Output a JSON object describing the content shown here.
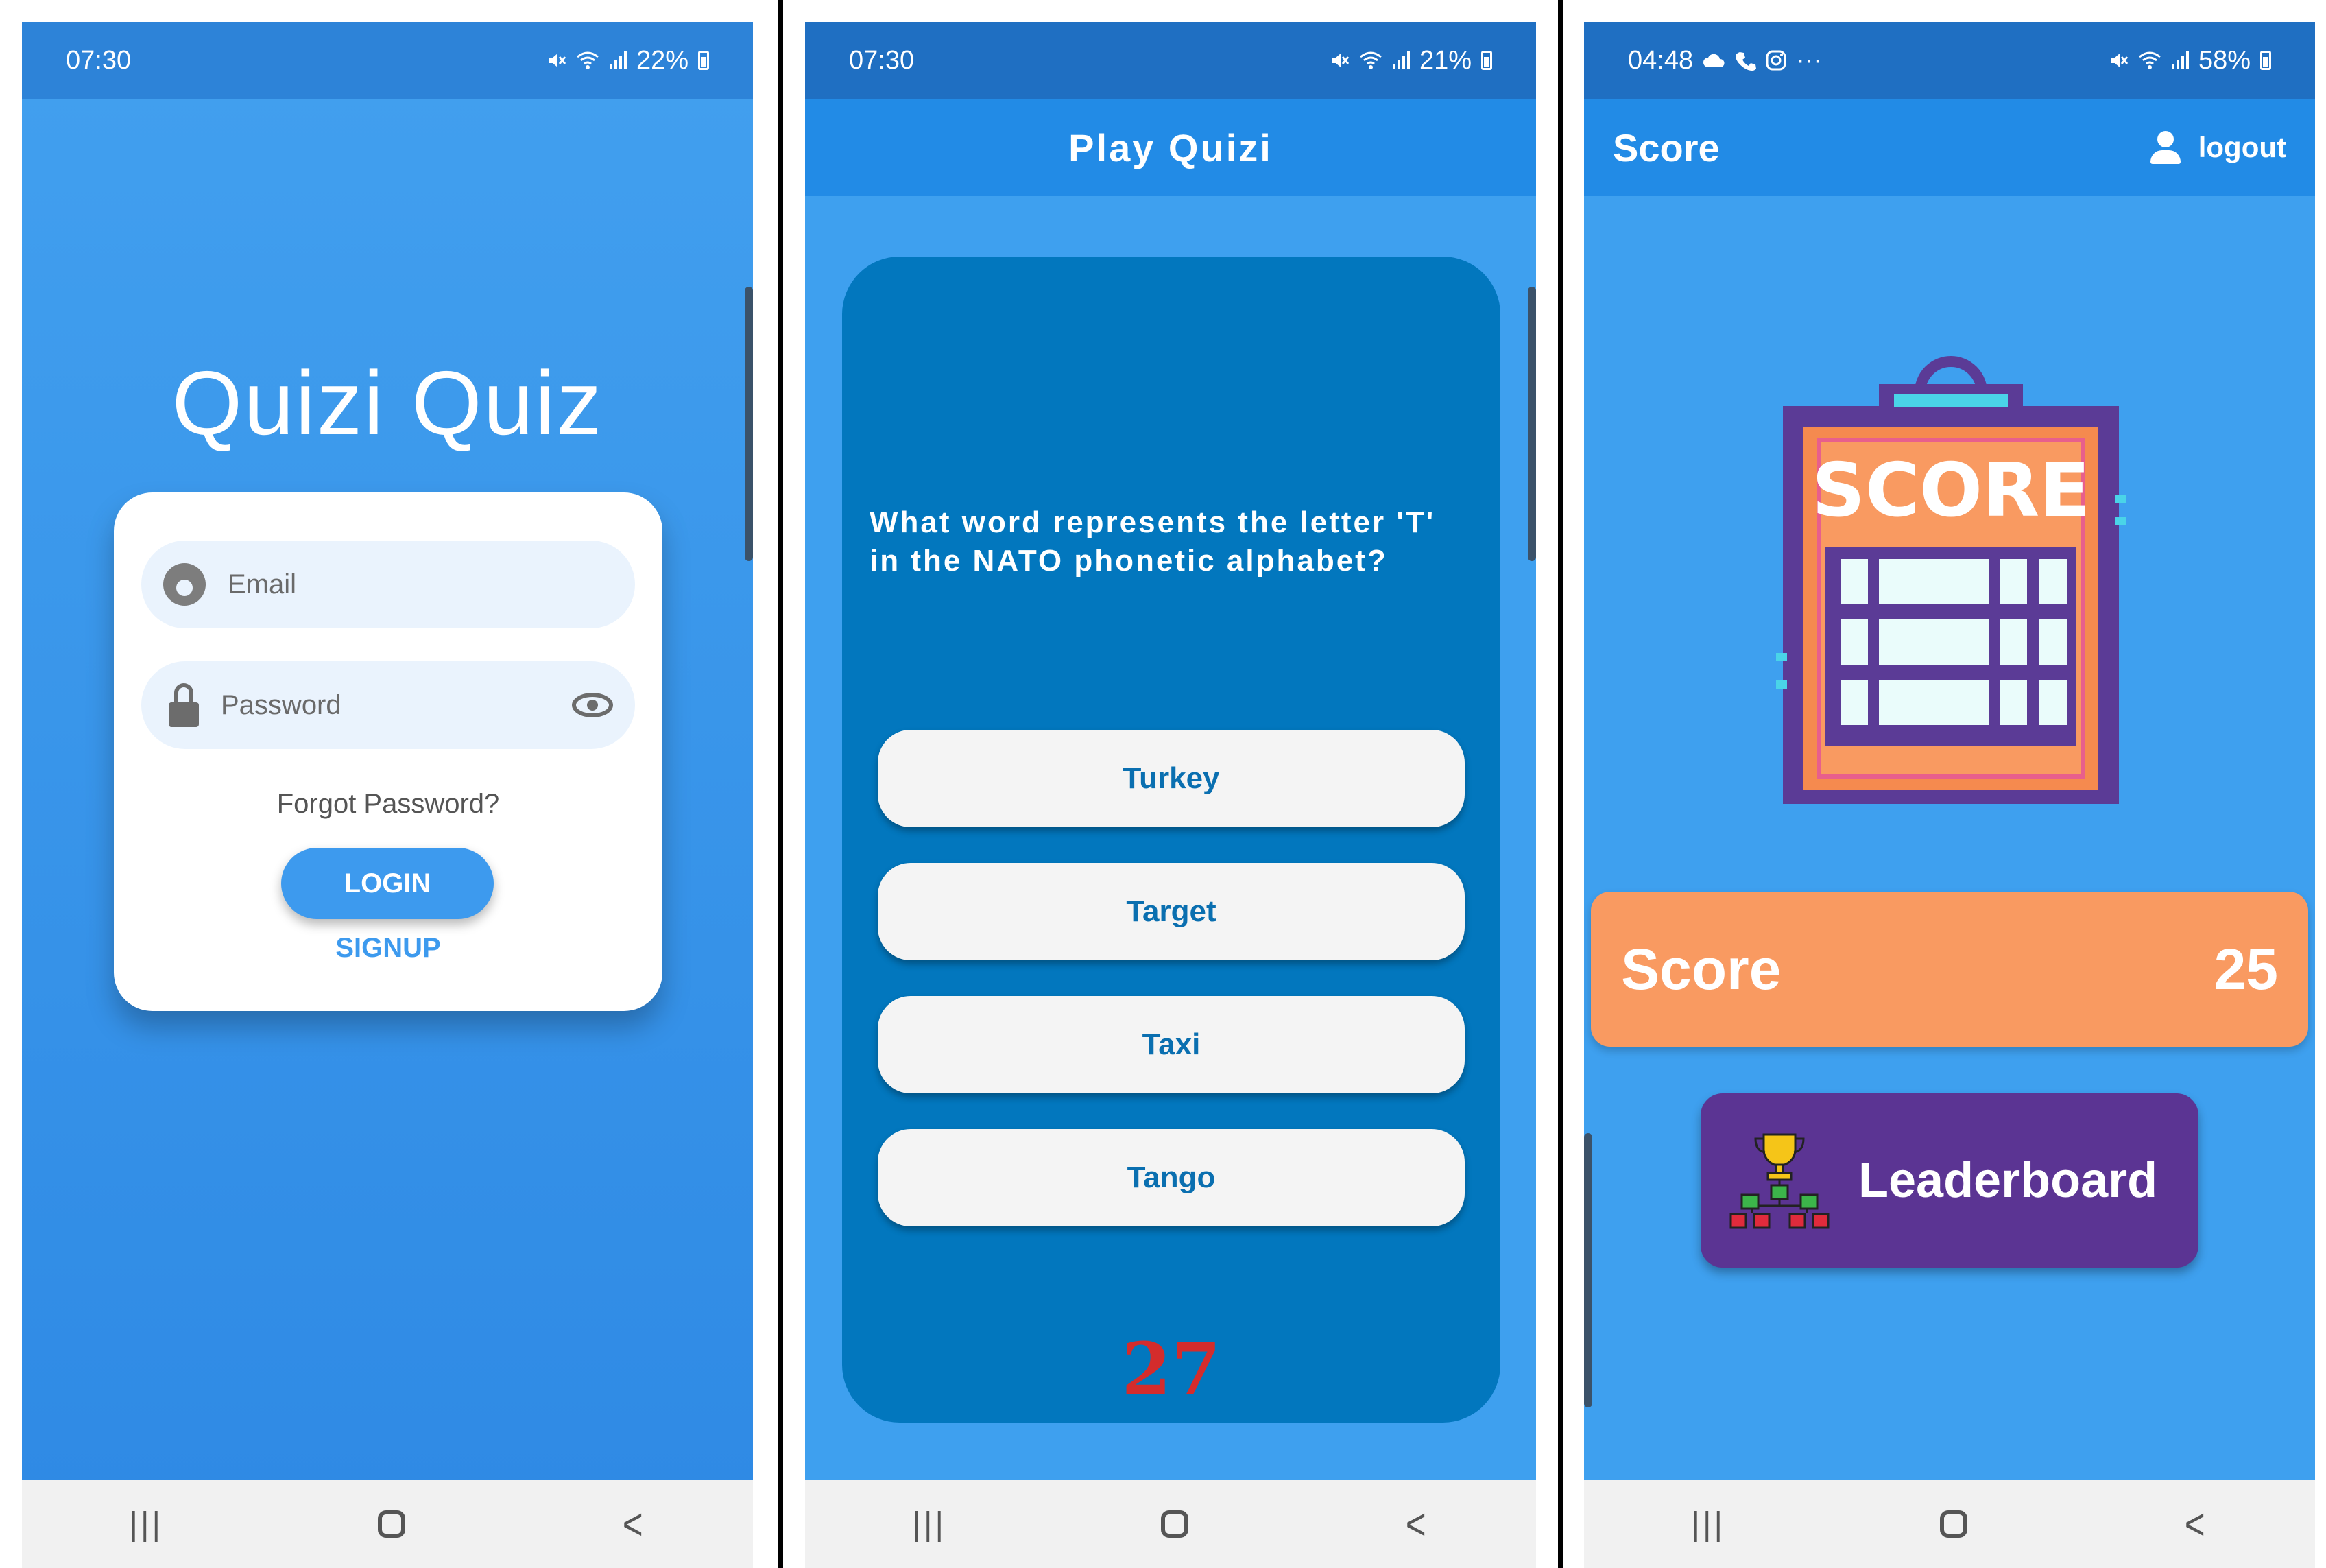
{
  "screens": {
    "login": {
      "status": {
        "time": "07:30",
        "battery": "22%"
      },
      "app_title": "Quizi Quiz",
      "email_placeholder": "Email",
      "password_placeholder": "Password",
      "forgot_password": "Forgot Password?",
      "login_label": "LOGIN",
      "signup_label": "SIGNUP"
    },
    "quiz": {
      "status": {
        "time": "07:30",
        "battery": "21%"
      },
      "title": "Play Quizi",
      "question": "What word represents the letter 'T' in the NATO phonetic alphabet?",
      "answers": [
        "Turkey",
        "Target",
        "Taxi",
        "Tango"
      ],
      "timer": "27"
    },
    "score": {
      "status": {
        "time": "04:48",
        "more": "···",
        "battery": "58%"
      },
      "title": "Score",
      "logout_label": "logout",
      "art_text": "SCORE",
      "score_label": "Score",
      "score_value": "25",
      "leaderboard_label": "Leaderboard"
    }
  },
  "system_nav": {
    "recent": "|||",
    "back": "<"
  },
  "colors": {
    "primary_blue": "#3ea0ef",
    "appbar_blue": "#228be6",
    "card_blue": "#0277be",
    "timer_red": "#d42c2c",
    "score_orange": "#f99a61",
    "leaderboard_purple": "#5b3493"
  },
  "icons": {
    "status_left": [
      "cloud-icon",
      "phone-icon",
      "instagram-icon"
    ],
    "status_right": [
      "mute-icon",
      "wifi-icon",
      "signal-icon",
      "battery-icon"
    ],
    "email": "account-circle-icon",
    "password": "lock-icon",
    "visibility": "eye-icon",
    "logout": "person-icon",
    "leaderboard": "trophy-hierarchy-icon"
  }
}
